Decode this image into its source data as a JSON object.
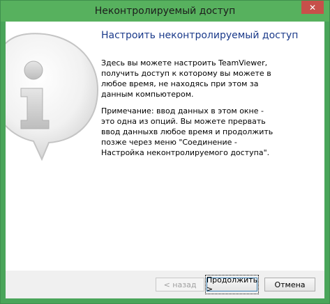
{
  "window": {
    "title": "Неконтролируемый доступ",
    "close_glyph": "✕"
  },
  "content": {
    "heading": "Настроить неконтролируемый доступ",
    "paragraph1": "Здесь вы можете настроить TeamViewer, получить доступ к которому вы можете в любое время, не находясь при этом за данным компьютером.",
    "paragraph2": "Примечание: ввод данных в этом окне  - это одна из опций. Вы можете прервать ввод данныхв любое время и продолжить позже через меню \"Соединение - Настройка неконтролируемого доступа\"."
  },
  "buttons": {
    "back": "< назад",
    "next": "Продолжить >",
    "cancel": "Отмена"
  },
  "icons": {
    "info": "info-bubble-icon"
  },
  "colors": {
    "titlebar": "#57b15e",
    "close_button": "#c7504a",
    "heading": "#1a3a8a"
  }
}
